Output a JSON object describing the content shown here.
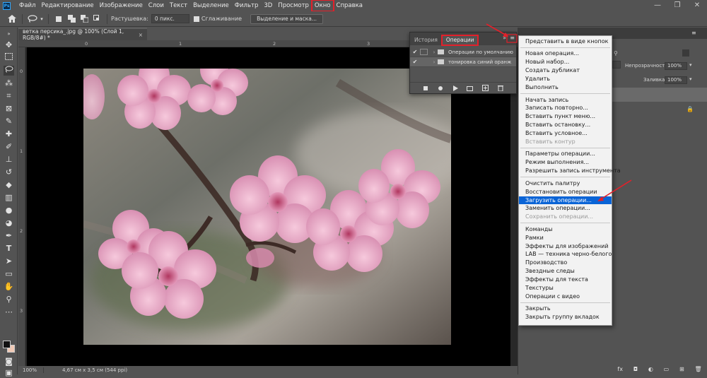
{
  "menubar": {
    "logo": "Ps",
    "items": [
      "Файл",
      "Редактирование",
      "Изображение",
      "Слои",
      "Текст",
      "Выделение",
      "Фильтр",
      "3D",
      "Просмотр",
      "Окно",
      "Справка"
    ],
    "highlighted": "Окно",
    "window_controls": [
      "—",
      "❐",
      "✕"
    ]
  },
  "options_bar": {
    "feather_label": "Растушевка:",
    "feather_value": "0 пикс.",
    "antialias_label": "Сглаживание",
    "select_mask_button": "Выделение и маска..."
  },
  "document": {
    "tab_title": "ветка персика_.jpg @ 100% (Слой 1, RGB/8#) *",
    "close": "×",
    "zoom": "100%",
    "status_info": "4,67 см x 3,5 см (544 ppi)",
    "ruler_top_marks": [
      "0",
      "1",
      "2",
      "3",
      "4"
    ],
    "ruler_left_marks": [
      "0",
      "1",
      "2",
      "3"
    ]
  },
  "actions_panel": {
    "tabs": [
      "История",
      "Операции"
    ],
    "active_tab": "Операции",
    "collapse_icon": "»",
    "menu_icon": "≡",
    "rows": [
      {
        "label": "Операции по умолчанию",
        "check": "✔"
      },
      {
        "label": "тонировка синий оранж",
        "check": "✔"
      }
    ],
    "footer_icons": [
      "stop-icon",
      "record-icon",
      "play-icon",
      "new-set-icon",
      "new-action-icon",
      "delete-icon"
    ]
  },
  "flyout_menu": {
    "groups": [
      [
        {
          "label": "Представить в виде кнопок"
        }
      ],
      [
        {
          "label": "Новая операция..."
        },
        {
          "label": "Новый набор..."
        },
        {
          "label": "Создать дубликат"
        },
        {
          "label": "Удалить"
        },
        {
          "label": "Выполнить"
        }
      ],
      [
        {
          "label": "Начать запись"
        },
        {
          "label": "Записать повторно..."
        },
        {
          "label": "Вставить пункт меню..."
        },
        {
          "label": "Вставить остановку..."
        },
        {
          "label": "Вставить условное..."
        },
        {
          "label": "Вставить контур",
          "disabled": true
        }
      ],
      [
        {
          "label": "Параметры операции..."
        },
        {
          "label": "Режим выполнения..."
        },
        {
          "label": "Разрешить запись инструмента"
        }
      ],
      [
        {
          "label": "Очистить палитру"
        },
        {
          "label": "Восстановить операции"
        },
        {
          "label": "Загрузить операции...",
          "highlighted": true
        },
        {
          "label": "Заменить операции..."
        },
        {
          "label": "Сохранить операции...",
          "disabled": true
        }
      ],
      [
        {
          "label": "Команды"
        },
        {
          "label": "Рамки"
        },
        {
          "label": "Эффекты для изображений"
        },
        {
          "label": "LAB — техника черно-белого"
        },
        {
          "label": "Производство"
        },
        {
          "label": "Звездные следы"
        },
        {
          "label": "Эффекты для текста"
        },
        {
          "label": "Текстуры"
        },
        {
          "label": "Операции с видео"
        }
      ],
      [
        {
          "label": "Закрыть"
        },
        {
          "label": "Закрыть группу вкладок"
        }
      ]
    ]
  },
  "layers_panel": {
    "opacity_label": "Непрозрачность:",
    "opacity_value": "100%",
    "fill_label": "Заливка:",
    "fill_value": "100%",
    "bottom_icons": [
      "fx",
      "mask-icon",
      "adjustment-icon",
      "group-icon",
      "new-layer-icon",
      "trash-icon"
    ],
    "bottom_glyphs": [
      "fx",
      "◘",
      "◐",
      "▭",
      "⊞",
      "🗑"
    ]
  },
  "colors": {
    "ui_bg": "#535353",
    "canvas_bg": "#000000",
    "highlight_red": "#e3202a",
    "menu_highlight": "#0a64d6",
    "blossom": "#e8a6c4"
  }
}
